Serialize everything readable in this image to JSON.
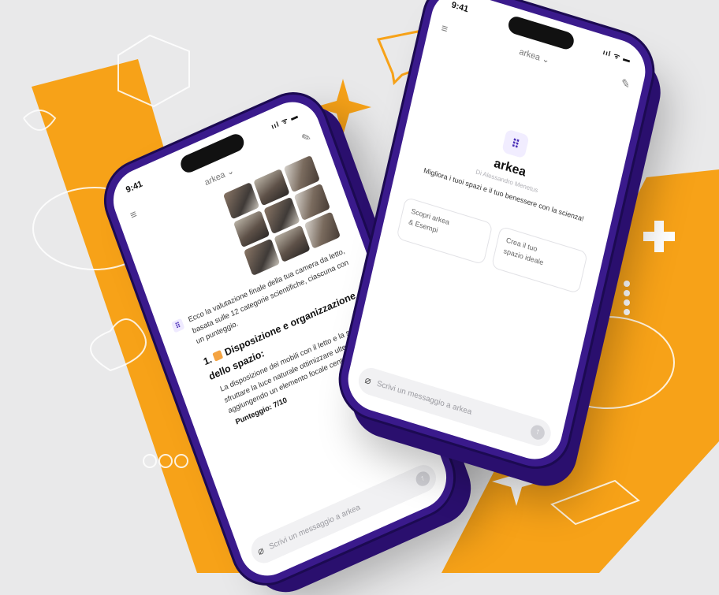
{
  "colors": {
    "accent": "#f7a218",
    "phone": "#3a1a8c",
    "background": "#e9e9ea"
  },
  "left_phone": {
    "status_time": "9:41",
    "status_icons": "ııl ᯤ ▬",
    "model_name": "arkea ⌄",
    "menu_icon": "≡",
    "edit_icon": "✎",
    "message_intro": "Ecco la valutazione finale della tua camera da letto, basata sulle 12 categorie scientifiche, ciascuna con un punteggio.",
    "section_number": "1.",
    "section_title": "Disposizione e organizzazione dello spazio:",
    "section_body": "La disposizione dei mobili con il letto e la scrivania sfruttare la luce naturale ottimizzare ulteriormente aggiungendo un elemento focale centrale.",
    "score": "Punteggio: 7/10",
    "input_placeholder": "Scrivi un messaggio a arkea"
  },
  "right_phone": {
    "status_time": "9:41",
    "status_icons": "ııl ᯤ ▬",
    "model_name": "arkea ⌄",
    "menu_icon": "≡",
    "edit_icon": "✎",
    "logo_glyph": "⠿",
    "app_name": "arkea",
    "author": "Di Alessandro Menetus",
    "tagline": "Migliora i tuoi spazi e il tuo benessere con la scienza!",
    "cards": [
      {
        "line1": "Scopri arkea",
        "line2": "& Esempi"
      },
      {
        "line1": "Crea il tuo",
        "line2": "spazio ideale"
      }
    ],
    "input_placeholder": "Scrivi un messaggio a arkea"
  }
}
